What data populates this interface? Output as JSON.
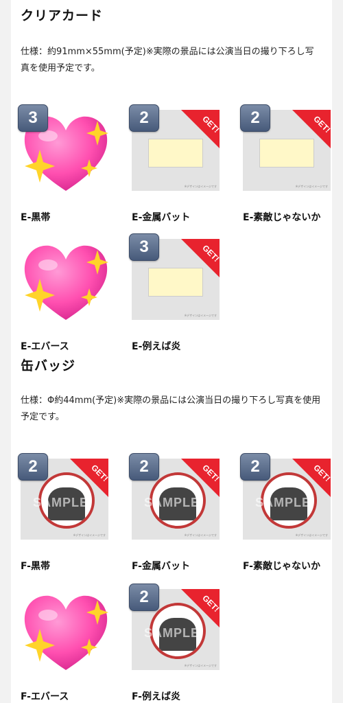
{
  "sections": [
    {
      "title": "クリアカード",
      "description": "仕様：約91mm×55mm(予定)※実際の景品には公演当日の撮り下ろし写真を使用予定です。",
      "items": [
        {
          "label": "E-黒帯",
          "count": "3",
          "get": "",
          "heart": true
        },
        {
          "label": "E-金属バット",
          "count": "2",
          "get": "GET!",
          "heart": false
        },
        {
          "label": "E-素敵じゃないか",
          "count": "2",
          "get": "GET!",
          "heart": false
        },
        {
          "label": "E-エバース",
          "count": "",
          "get": "",
          "heart": true
        },
        {
          "label": "E-例えば炎",
          "count": "3",
          "get": "GET!",
          "heart": false
        }
      ]
    },
    {
      "title": "缶バッジ",
      "description": "仕様：Φ約44mm(予定)※実際の景品には公演当日の撮り下ろし写真を使用予定です。",
      "items": [
        {
          "label": "F-黒帯",
          "count": "2",
          "get": "GET!",
          "heart": false
        },
        {
          "label": "F-金属バット",
          "count": "2",
          "get": "GET!",
          "heart": false
        },
        {
          "label": "F-素敵じゃないか",
          "count": "2",
          "get": "GET!",
          "heart": false
        },
        {
          "label": "F-エバース",
          "count": "",
          "get": "",
          "heart": true
        },
        {
          "label": "F-例えば炎",
          "count": "2",
          "get": "GET!",
          "heart": false
        }
      ]
    }
  ],
  "image_note": "※デザインはイメージです",
  "sample_watermark": "SAMPLE",
  "colors": {
    "get_ribbon": "#e8232e",
    "badge": "#5a6b8a",
    "heart": "#ff4fb0",
    "sparkle": "#ffd42a"
  }
}
